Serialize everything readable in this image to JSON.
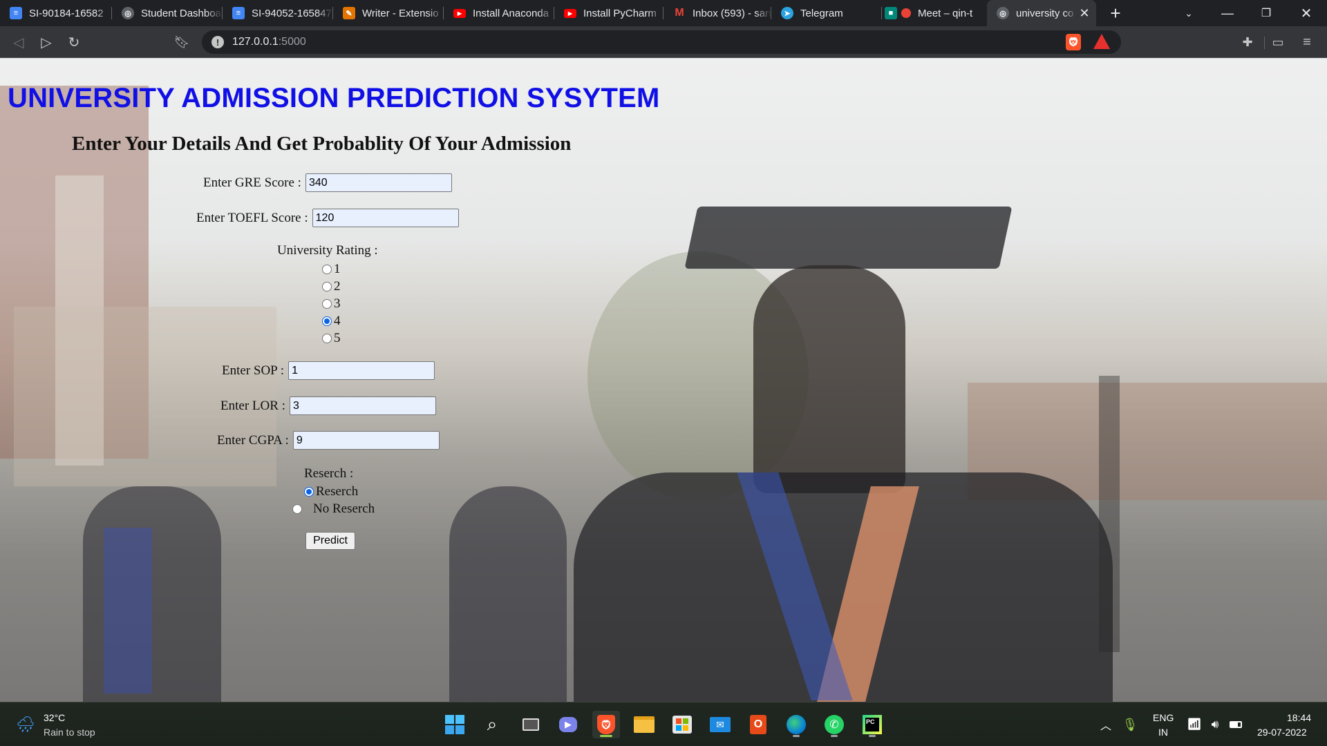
{
  "browser": {
    "tabs": [
      {
        "label": "SI-90184-16582",
        "icon": "docs-icon",
        "color": "#4285f4"
      },
      {
        "label": "Student Dashboa",
        "icon": "globe-icon",
        "color": "#9aa0a6"
      },
      {
        "label": "SI-94052-165847",
        "icon": "docs-icon",
        "color": "#4285f4"
      },
      {
        "label": "Writer - Extensio",
        "icon": "writer-icon",
        "color": "#e37400"
      },
      {
        "label": "Install Anaconda",
        "icon": "youtube-icon",
        "color": "#ff0000"
      },
      {
        "label": "Install PyCharm",
        "icon": "youtube-icon",
        "color": "#ff0000"
      },
      {
        "label": "Inbox (593) - san",
        "icon": "gmail-icon",
        "color": "#ea4335"
      },
      {
        "label": "Telegram",
        "icon": "telegram-icon",
        "color": "#2aa3e0"
      },
      {
        "label": "Meet – qin-t",
        "icon": "meet-icon",
        "color": "#00897b"
      },
      {
        "label": "university co",
        "icon": "globe-icon",
        "color": "#9aa0a6",
        "active": true
      }
    ],
    "address": {
      "host": "127.0.0.1",
      "port": ":5000"
    }
  },
  "page": {
    "title": "UNIVERSITY ADMISSION PREDICTION SYSYTEM",
    "subtitle": "Enter Your Details And Get Probablity Of Your Admission",
    "form": {
      "gre_label": "Enter GRE Score :",
      "gre_value": "340",
      "toefl_label": "Enter TOEFL Score :",
      "toefl_value": "120",
      "rating_label": "University Rating :",
      "rating_options": [
        "1",
        "2",
        "3",
        "4",
        "5"
      ],
      "rating_selected": "4",
      "sop_label": "Enter SOP :",
      "sop_value": "1",
      "lor_label": "Enter LOR :",
      "lor_value": "3",
      "cgpa_label": "Enter CGPA :",
      "cgpa_value": "9",
      "research_label": "Reserch :",
      "research_options": [
        "Reserch",
        "No Reserch"
      ],
      "research_selected": "Reserch",
      "predict_button": "Predict"
    }
  },
  "taskbar": {
    "weather_temp": "32°C",
    "weather_desc": "Rain to stop",
    "lang_top": "ENG",
    "lang_bottom": "IN",
    "time": "18:44",
    "date": "29-07-2022"
  }
}
